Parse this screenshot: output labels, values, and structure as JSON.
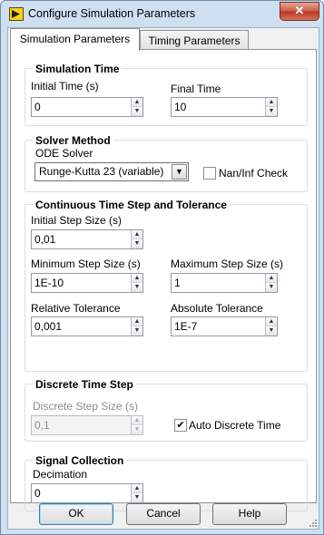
{
  "window": {
    "title": "Configure Simulation Parameters",
    "close_label": "✕"
  },
  "tabs": [
    {
      "label": "Simulation Parameters",
      "active": true
    },
    {
      "label": "Timing Parameters",
      "active": false
    }
  ],
  "simulation_time": {
    "title": "Simulation Time",
    "initial_time": {
      "label": "Initial Time (s)",
      "value": "0"
    },
    "final_time": {
      "label": "Final Time",
      "value": "10"
    }
  },
  "solver_method": {
    "title": "Solver Method",
    "ode_solver": {
      "label": "ODE Solver",
      "value": "Runge-Kutta 23 (variable)"
    },
    "nan_inf_check": {
      "label": "Nan/Inf Check",
      "checked": false
    }
  },
  "continuous": {
    "title": "Continuous Time Step and Tolerance",
    "initial_step": {
      "label": "Initial Step Size (s)",
      "value": "0,01"
    },
    "min_step": {
      "label": "Minimum Step Size (s)",
      "value": "1E-10"
    },
    "max_step": {
      "label": "Maximum Step Size (s)",
      "value": "1"
    },
    "rel_tol": {
      "label": "Relative Tolerance",
      "value": "0,001"
    },
    "abs_tol": {
      "label": "Absolute Tolerance",
      "value": "1E-7"
    }
  },
  "discrete": {
    "title": "Discrete Time Step",
    "step_size": {
      "label": "Discrete Step Size (s)",
      "value": "0,1"
    },
    "auto": {
      "label": "Auto Discrete Time",
      "checked": true
    }
  },
  "signal_collection": {
    "title": "Signal Collection",
    "decimation": {
      "label": "Decimation",
      "value": "0"
    }
  },
  "buttons": {
    "ok": "OK",
    "cancel": "Cancel",
    "help": "Help"
  },
  "colors": {
    "title_bar": "#cfdff0",
    "close_button": "#c75a43",
    "group_border": "#d5dfe5"
  }
}
